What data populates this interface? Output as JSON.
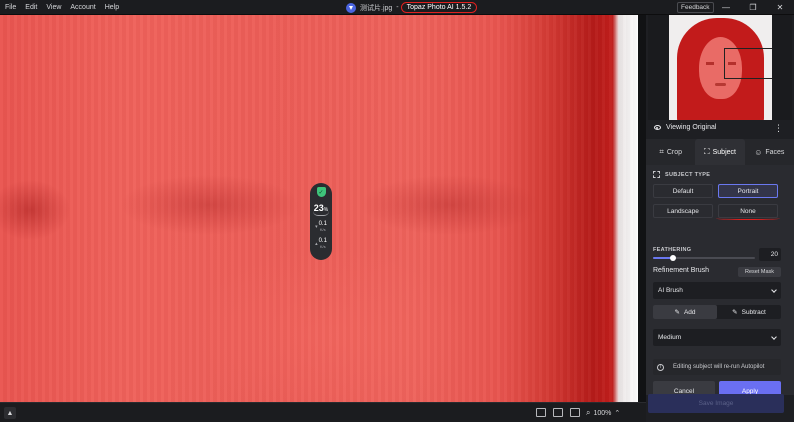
{
  "menu": [
    "File",
    "Edit",
    "View",
    "Account",
    "Help"
  ],
  "title": {
    "filename": "测试片.jpg",
    "separator": "-",
    "app": "Topaz Photo AI 1.5.2"
  },
  "feedback_label": "Feedback",
  "window_controls": {
    "minimize": "—",
    "maximize": "❐",
    "close": "✕"
  },
  "stats": {
    "percent": "23",
    "percent_unit": "%",
    "stat1_value": "0.1",
    "stat1_unit": "K/s",
    "stat2_value": "0.1",
    "stat2_unit": "K/s"
  },
  "bottom": {
    "zoom": "100%"
  },
  "panel": {
    "viewing": "Viewing Original",
    "tabs": [
      {
        "label": "Crop"
      },
      {
        "label": "Subject"
      },
      {
        "label": "Faces"
      }
    ],
    "section_title": "SUBJECT TYPE",
    "subject_types": [
      "Default",
      "Portrait",
      "Landscape",
      "None"
    ],
    "selected_subject_type": "Portrait",
    "feathering": {
      "label": "FEATHERING",
      "value": "20",
      "level_fraction": 0.2
    },
    "refinement": {
      "label": "Refinement Brush",
      "reset": "Reset Mask"
    },
    "brush": "AI Brush",
    "add_label": "Add",
    "subtract_label": "Subtract",
    "size": "Medium",
    "info": "Editing subject will re-run Autopilot",
    "cancel": "Cancel",
    "apply": "Apply",
    "save": "Save Image"
  },
  "colors": {
    "accent": "#6a6ff2",
    "annotation": "#e0201e",
    "mask": "#e95550"
  }
}
